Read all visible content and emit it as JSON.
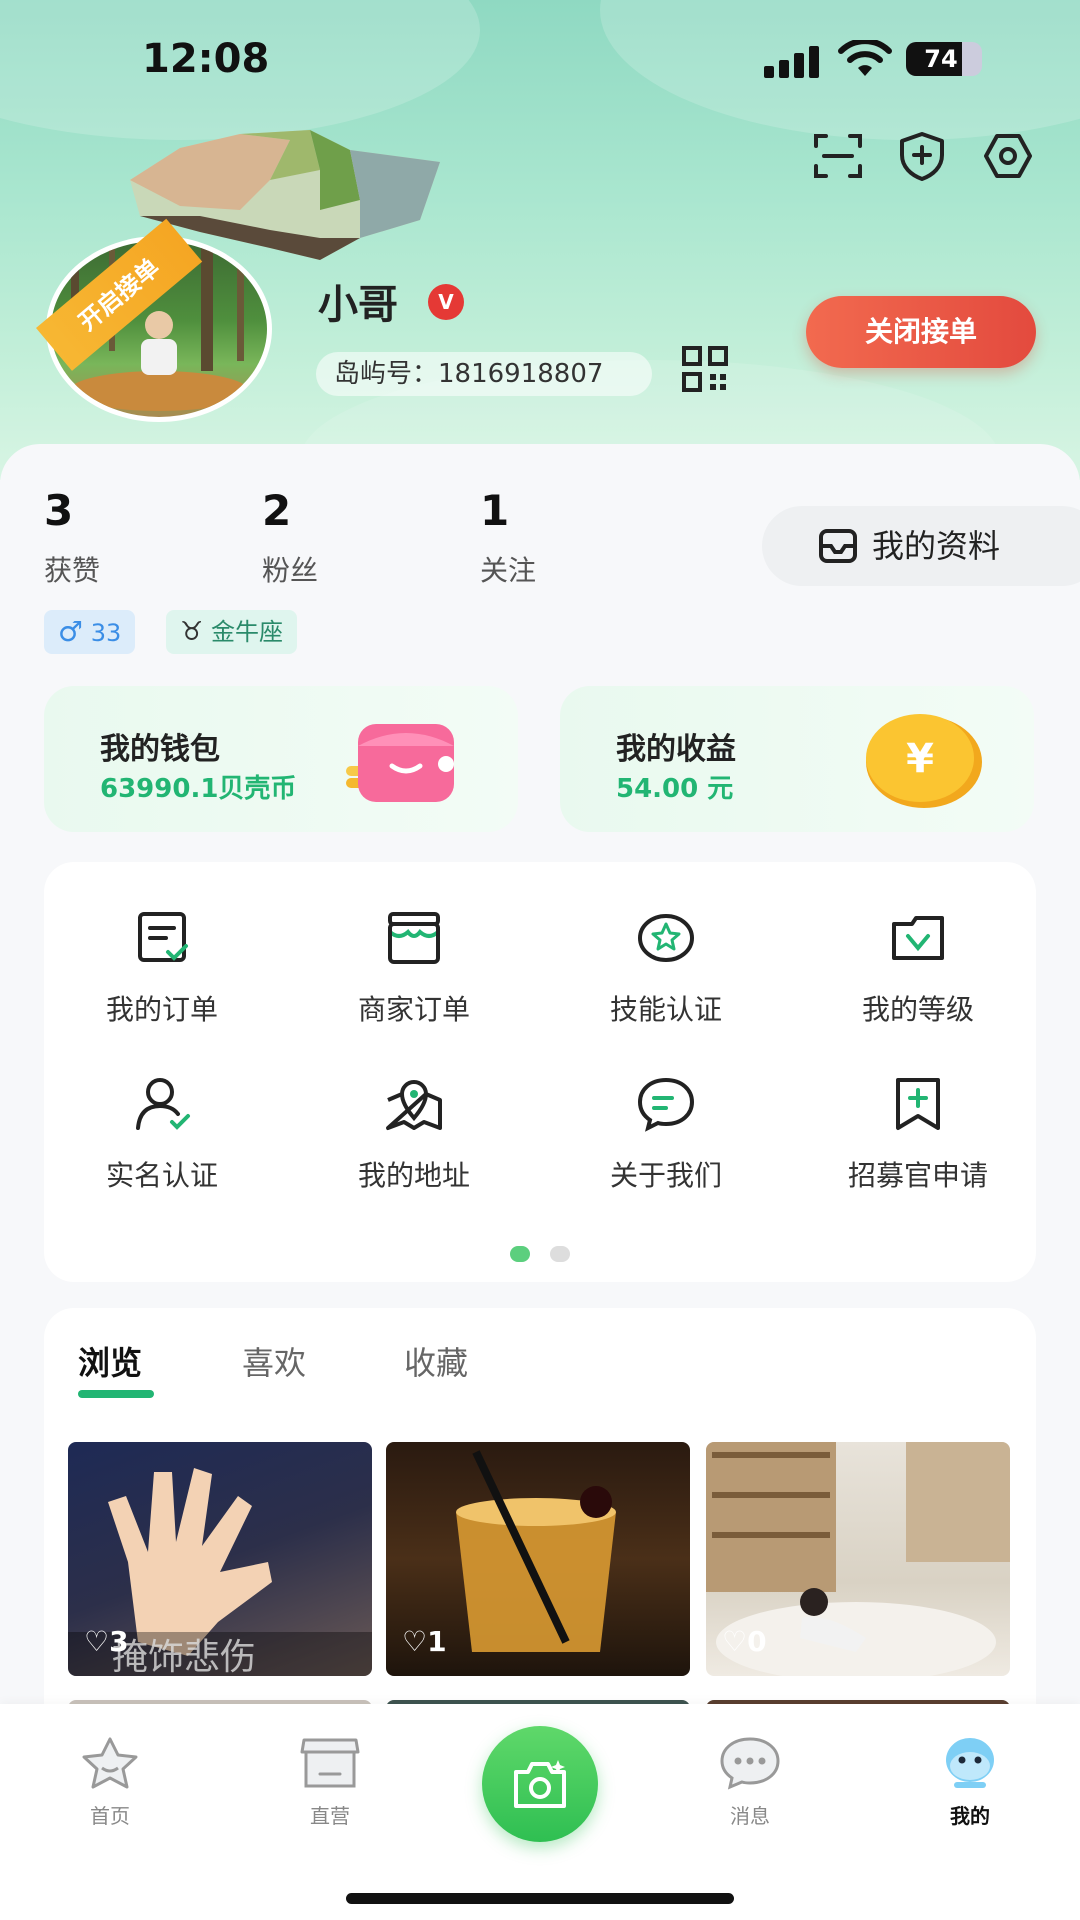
{
  "status_bar": {
    "time": "12:08",
    "battery": "74",
    "battery_level": 0.74
  },
  "header": {
    "ribbon": "开启接单",
    "name": "小哥",
    "verified_badge": "V",
    "island_id": "岛屿号：1816918807",
    "close_orders_button": "关闭接单",
    "icons": [
      "scan-icon",
      "shield-icon",
      "settings-icon"
    ]
  },
  "stats": [
    {
      "value": "3",
      "label": "获赞"
    },
    {
      "value": "2",
      "label": "粉丝"
    },
    {
      "value": "1",
      "label": "关注"
    }
  ],
  "profile_button": "我的资料",
  "tags": {
    "gender_age": "33",
    "zodiac": "金牛座"
  },
  "wallet": {
    "title": "我的钱包",
    "value": "63990.1贝壳币"
  },
  "earnings": {
    "title": "我的收益",
    "value": "54.00 元"
  },
  "menu": [
    {
      "label": "我的订单",
      "icon": "order-icon"
    },
    {
      "label": "商家订单",
      "icon": "merchant-icon"
    },
    {
      "label": "技能认证",
      "icon": "skill-icon"
    },
    {
      "label": "我的等级",
      "icon": "level-icon"
    },
    {
      "label": "实名认证",
      "icon": "user-verify-icon"
    },
    {
      "label": "我的地址",
      "icon": "address-icon"
    },
    {
      "label": "关于我们",
      "icon": "about-icon"
    },
    {
      "label": "招募官申请",
      "icon": "recruit-icon"
    }
  ],
  "feed_tabs": [
    "浏览",
    "喜欢",
    "收藏"
  ],
  "feed_items": [
    {
      "likes": "3",
      "caption": "掩饰悲伤"
    },
    {
      "likes": "1"
    },
    {
      "likes": "0"
    }
  ],
  "bottom_nav": [
    {
      "label": "首页",
      "icon": "home-star-icon"
    },
    {
      "label": "直营",
      "icon": "store-icon"
    },
    {
      "label": "",
      "icon": "camera-icon"
    },
    {
      "label": "消息",
      "icon": "message-icon"
    },
    {
      "label": "我的",
      "icon": "me-icon"
    }
  ],
  "colors": {
    "accent": "#22b573",
    "close_button": "#e8503f",
    "ribbon": "#f5a623"
  }
}
